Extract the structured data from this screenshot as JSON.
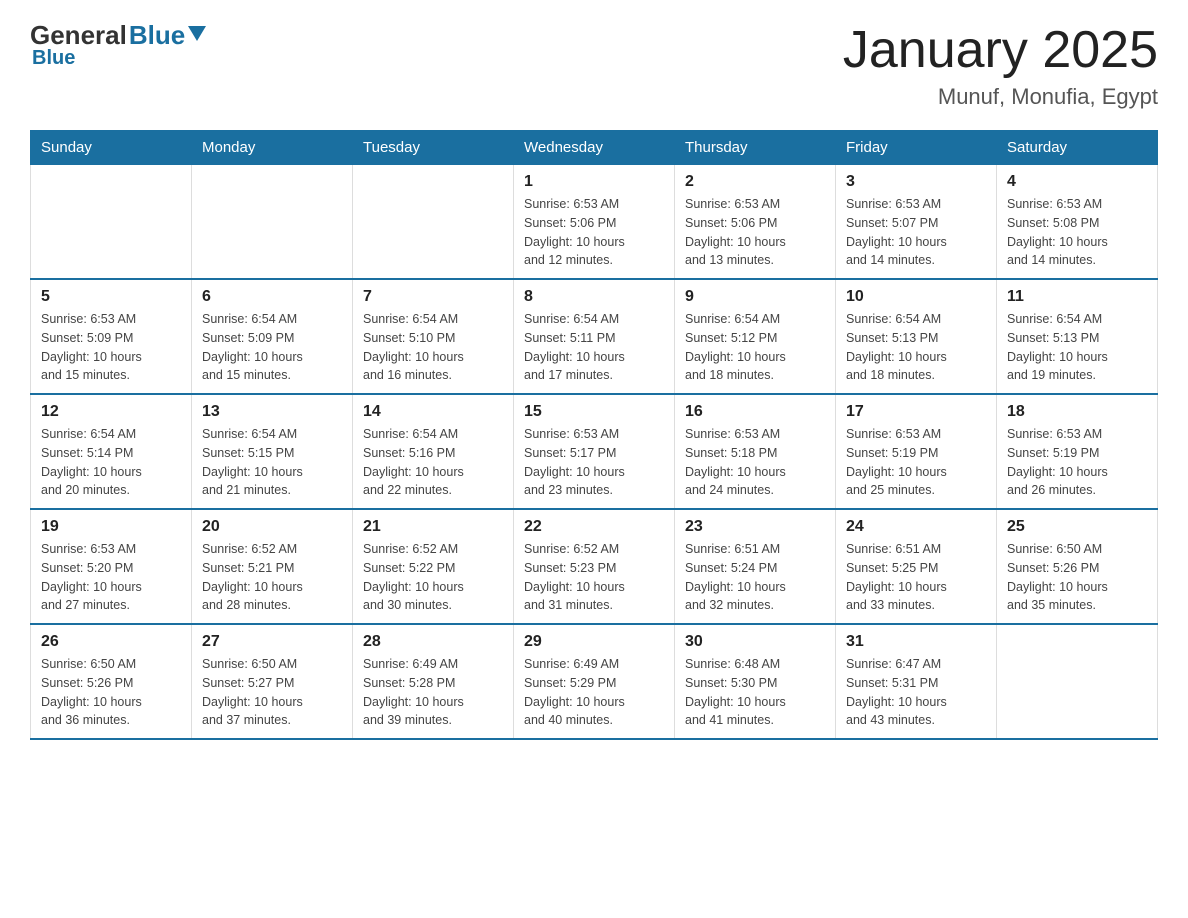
{
  "header": {
    "logo": {
      "general": "General",
      "blue": "Blue",
      "tagline": "Blue"
    },
    "title": "January 2025",
    "subtitle": "Munuf, Monufia, Egypt"
  },
  "days_of_week": [
    "Sunday",
    "Monday",
    "Tuesday",
    "Wednesday",
    "Thursday",
    "Friday",
    "Saturday"
  ],
  "weeks": [
    [
      {
        "day": "",
        "info": ""
      },
      {
        "day": "",
        "info": ""
      },
      {
        "day": "",
        "info": ""
      },
      {
        "day": "1",
        "info": "Sunrise: 6:53 AM\nSunset: 5:06 PM\nDaylight: 10 hours\nand 12 minutes."
      },
      {
        "day": "2",
        "info": "Sunrise: 6:53 AM\nSunset: 5:06 PM\nDaylight: 10 hours\nand 13 minutes."
      },
      {
        "day": "3",
        "info": "Sunrise: 6:53 AM\nSunset: 5:07 PM\nDaylight: 10 hours\nand 14 minutes."
      },
      {
        "day": "4",
        "info": "Sunrise: 6:53 AM\nSunset: 5:08 PM\nDaylight: 10 hours\nand 14 minutes."
      }
    ],
    [
      {
        "day": "5",
        "info": "Sunrise: 6:53 AM\nSunset: 5:09 PM\nDaylight: 10 hours\nand 15 minutes."
      },
      {
        "day": "6",
        "info": "Sunrise: 6:54 AM\nSunset: 5:09 PM\nDaylight: 10 hours\nand 15 minutes."
      },
      {
        "day": "7",
        "info": "Sunrise: 6:54 AM\nSunset: 5:10 PM\nDaylight: 10 hours\nand 16 minutes."
      },
      {
        "day": "8",
        "info": "Sunrise: 6:54 AM\nSunset: 5:11 PM\nDaylight: 10 hours\nand 17 minutes."
      },
      {
        "day": "9",
        "info": "Sunrise: 6:54 AM\nSunset: 5:12 PM\nDaylight: 10 hours\nand 18 minutes."
      },
      {
        "day": "10",
        "info": "Sunrise: 6:54 AM\nSunset: 5:13 PM\nDaylight: 10 hours\nand 18 minutes."
      },
      {
        "day": "11",
        "info": "Sunrise: 6:54 AM\nSunset: 5:13 PM\nDaylight: 10 hours\nand 19 minutes."
      }
    ],
    [
      {
        "day": "12",
        "info": "Sunrise: 6:54 AM\nSunset: 5:14 PM\nDaylight: 10 hours\nand 20 minutes."
      },
      {
        "day": "13",
        "info": "Sunrise: 6:54 AM\nSunset: 5:15 PM\nDaylight: 10 hours\nand 21 minutes."
      },
      {
        "day": "14",
        "info": "Sunrise: 6:54 AM\nSunset: 5:16 PM\nDaylight: 10 hours\nand 22 minutes."
      },
      {
        "day": "15",
        "info": "Sunrise: 6:53 AM\nSunset: 5:17 PM\nDaylight: 10 hours\nand 23 minutes."
      },
      {
        "day": "16",
        "info": "Sunrise: 6:53 AM\nSunset: 5:18 PM\nDaylight: 10 hours\nand 24 minutes."
      },
      {
        "day": "17",
        "info": "Sunrise: 6:53 AM\nSunset: 5:19 PM\nDaylight: 10 hours\nand 25 minutes."
      },
      {
        "day": "18",
        "info": "Sunrise: 6:53 AM\nSunset: 5:19 PM\nDaylight: 10 hours\nand 26 minutes."
      }
    ],
    [
      {
        "day": "19",
        "info": "Sunrise: 6:53 AM\nSunset: 5:20 PM\nDaylight: 10 hours\nand 27 minutes."
      },
      {
        "day": "20",
        "info": "Sunrise: 6:52 AM\nSunset: 5:21 PM\nDaylight: 10 hours\nand 28 minutes."
      },
      {
        "day": "21",
        "info": "Sunrise: 6:52 AM\nSunset: 5:22 PM\nDaylight: 10 hours\nand 30 minutes."
      },
      {
        "day": "22",
        "info": "Sunrise: 6:52 AM\nSunset: 5:23 PM\nDaylight: 10 hours\nand 31 minutes."
      },
      {
        "day": "23",
        "info": "Sunrise: 6:51 AM\nSunset: 5:24 PM\nDaylight: 10 hours\nand 32 minutes."
      },
      {
        "day": "24",
        "info": "Sunrise: 6:51 AM\nSunset: 5:25 PM\nDaylight: 10 hours\nand 33 minutes."
      },
      {
        "day": "25",
        "info": "Sunrise: 6:50 AM\nSunset: 5:26 PM\nDaylight: 10 hours\nand 35 minutes."
      }
    ],
    [
      {
        "day": "26",
        "info": "Sunrise: 6:50 AM\nSunset: 5:26 PM\nDaylight: 10 hours\nand 36 minutes."
      },
      {
        "day": "27",
        "info": "Sunrise: 6:50 AM\nSunset: 5:27 PM\nDaylight: 10 hours\nand 37 minutes."
      },
      {
        "day": "28",
        "info": "Sunrise: 6:49 AM\nSunset: 5:28 PM\nDaylight: 10 hours\nand 39 minutes."
      },
      {
        "day": "29",
        "info": "Sunrise: 6:49 AM\nSunset: 5:29 PM\nDaylight: 10 hours\nand 40 minutes."
      },
      {
        "day": "30",
        "info": "Sunrise: 6:48 AM\nSunset: 5:30 PM\nDaylight: 10 hours\nand 41 minutes."
      },
      {
        "day": "31",
        "info": "Sunrise: 6:47 AM\nSunset: 5:31 PM\nDaylight: 10 hours\nand 43 minutes."
      },
      {
        "day": "",
        "info": ""
      }
    ]
  ]
}
